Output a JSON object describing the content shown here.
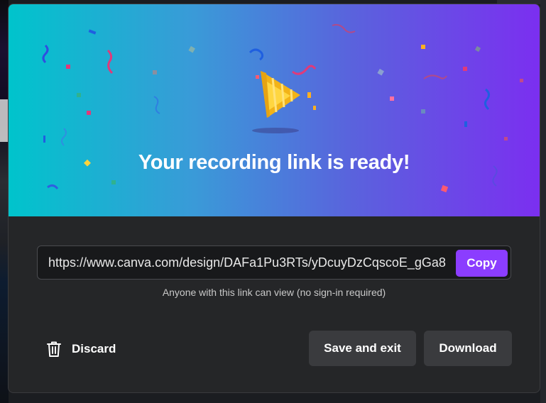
{
  "dialog": {
    "title": "Your recording link is ready!",
    "link_value": "https://www.canva.com/design/DAFa1Pu3RTs/yDcuyDzCqscoE_gGa8",
    "copy_label": "Copy",
    "link_note": "Anyone with this link can view (no sign-in required)",
    "discard_label": "Discard",
    "save_exit_label": "Save and exit",
    "download_label": "Download",
    "icons": {
      "hero": "party-popper-icon",
      "discard": "trash-icon"
    }
  },
  "colors": {
    "hero_gradient_start": "#00c4cc",
    "hero_gradient_end": "#7b2ff0",
    "accent": "#8b3dff",
    "dialog_bg": "#252628",
    "button_bg": "#3a3b3e"
  }
}
